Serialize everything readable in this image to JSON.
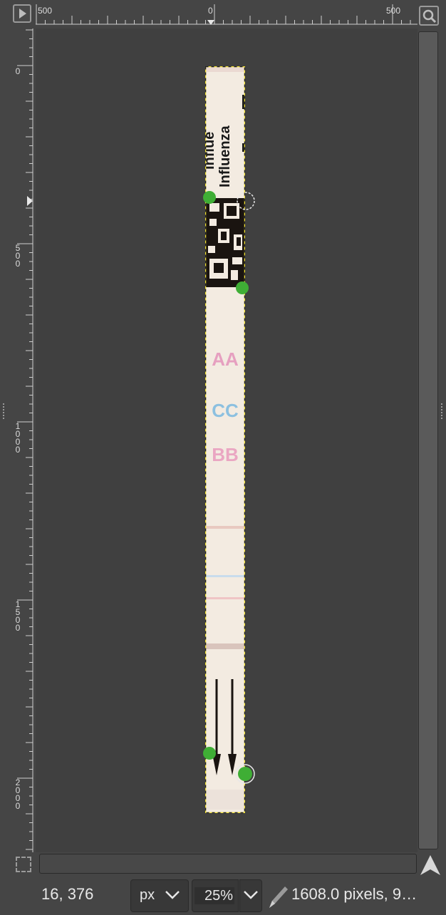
{
  "rulers": {
    "top_labels": [
      "500",
      "0",
      "500"
    ],
    "left_labels": [
      "0",
      "500",
      "1000",
      "1500",
      "2000"
    ]
  },
  "image_strip": {
    "text_top_partial": "Influe",
    "text_main": "Influenza",
    "letters_a": "AA",
    "letters_c": "CC",
    "letters_b": "BB"
  },
  "statusbar": {
    "coords": "16, 376",
    "unit": "px",
    "zoom": "25%",
    "status_text": "1608.0 pixels, 9…"
  },
  "colors": {
    "background": "#454545",
    "canvas": "#404040",
    "selection_outline": "#f0e030",
    "handle_green": "#3fae35"
  },
  "icons": {
    "corner": "menu-arrow-icon",
    "zoom": "zoom-lock-icon",
    "quick_mask": "quick-mask-icon",
    "navigate": "navigate-icon",
    "pencil": "pencil-icon",
    "dropdown": "chevron-down-icon"
  }
}
